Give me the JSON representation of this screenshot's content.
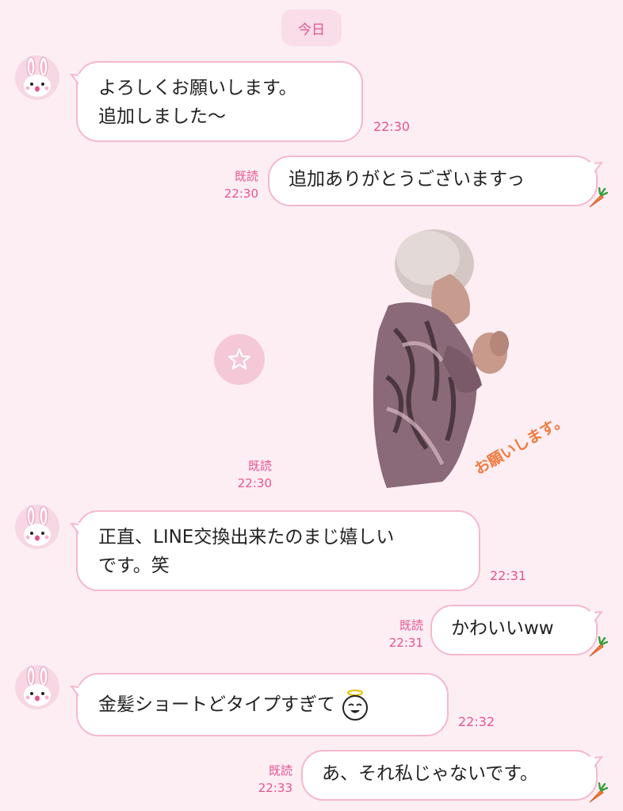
{
  "date_label": "今日",
  "messages": [
    {
      "lines": [
        "よろしくお願いします。",
        "追加しました〜"
      ],
      "time": "22:30"
    },
    {
      "text": "追加ありがとうございますっ",
      "read": "既読",
      "time": "22:30"
    },
    {
      "read": "既読",
      "time": "22:30",
      "sticker_text": "お願いします。",
      "favorite_icon": "star-icon"
    },
    {
      "lines": [
        "正直、LINE交換出来たのまじ嬉しい",
        "です。笑"
      ],
      "time": "22:31"
    },
    {
      "text": "かわいいww",
      "read": "既読",
      "time": "22:31"
    },
    {
      "text": "金髪ショートどタイプすぎて",
      "emoji": "angel-face-emoji",
      "time": "22:32"
    },
    {
      "text": "あ、それ私じゃないです。",
      "read": "既読",
      "time": "22:33"
    }
  ],
  "colors": {
    "background": "#fdeef4",
    "accent": "#e5558f",
    "bubble_border": "#f5b8cd",
    "avatar_bg": "#f7d7e3",
    "carrot": "#f07a3e"
  }
}
